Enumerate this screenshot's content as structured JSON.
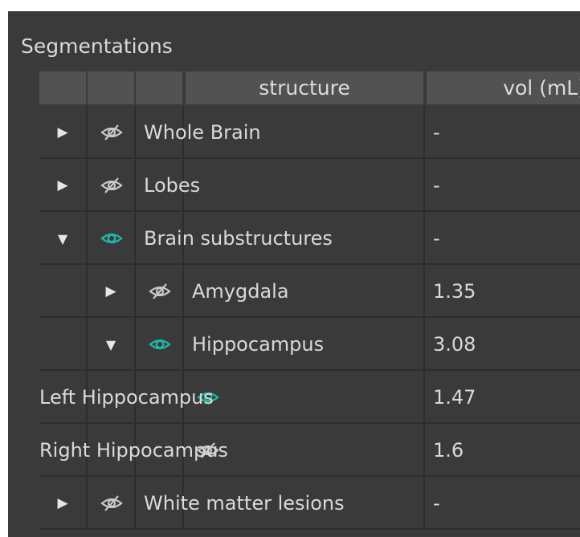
{
  "panel": {
    "title": "Segmentations"
  },
  "columns": {
    "structure": "structure",
    "volume": "vol (mL)"
  },
  "rows": [
    {
      "name": "Whole Brain",
      "vol": "-",
      "level": 0,
      "expander": "collapsed",
      "visible": false
    },
    {
      "name": "Lobes",
      "vol": "-",
      "level": 0,
      "expander": "collapsed",
      "visible": false
    },
    {
      "name": "Brain substructures",
      "vol": "-",
      "level": 0,
      "expander": "expanded",
      "visible": true
    },
    {
      "name": "Amygdala",
      "vol": "1.35",
      "level": 1,
      "expander": "collapsed",
      "visible": false
    },
    {
      "name": "Hippocampus",
      "vol": "3.08",
      "level": 1,
      "expander": "expanded",
      "visible": true
    },
    {
      "name": "Left Hippocampus",
      "vol": "1.47",
      "level": 2,
      "expander": "none",
      "visible": true
    },
    {
      "name": "Right Hippocampus",
      "vol": "1.6",
      "level": 2,
      "expander": "none",
      "visible": false
    },
    {
      "name": "White matter lesions",
      "vol": "-",
      "level": 0,
      "expander": "collapsed",
      "visible": false
    }
  ],
  "colors": {
    "eye_on": "#1fb5a5",
    "eye_off": "#c8c8c8"
  }
}
